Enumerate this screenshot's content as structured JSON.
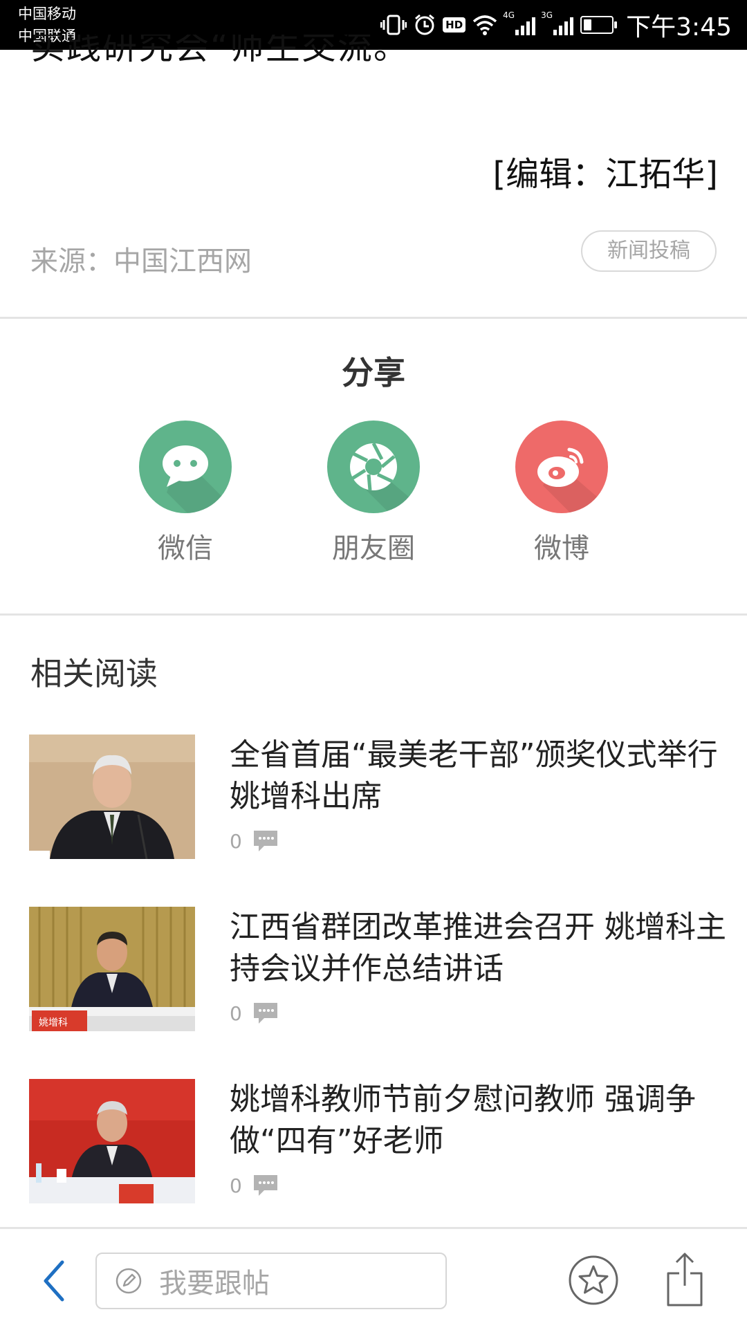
{
  "status_bar": {
    "carrier_1": "中国移动",
    "carrier_2": "中国联通",
    "hd": "HD",
    "net_1": "4G",
    "net_2": "3G",
    "battery_level": 0.3,
    "time": "下午3:45"
  },
  "article": {
    "partial_text": "实践研究会“师生交流。",
    "editor": "[编辑：江拓华]",
    "source": "来源：中国江西网",
    "submit_label": "新闻投稿"
  },
  "share": {
    "title": "分享",
    "items": [
      {
        "label": "微信",
        "icon": "wechat-icon",
        "color": "#5fb48b"
      },
      {
        "label": "朋友圈",
        "icon": "moments-icon",
        "color": "#5fb48b"
      },
      {
        "label": "微博",
        "icon": "weibo-icon",
        "color": "#ee6a69"
      }
    ]
  },
  "related": {
    "title": "相关阅读",
    "items": [
      {
        "title": "全省首届“最美老干部”颁奖仪式举行 姚增科出席",
        "comments": "0"
      },
      {
        "title": "江西省群团改革推进会召开 姚增科主持会议并作总结讲话",
        "comments": "0"
      },
      {
        "title": "姚增科教师节前夕慰问教师 强调争做“四有”好老师",
        "comments": "0"
      }
    ]
  },
  "bottom_bar": {
    "reply_placeholder": "我要跟帖",
    "back_icon": "back-arrow-icon",
    "favorite_icon": "star-icon",
    "share_icon": "share-icon"
  },
  "colors": {
    "accent_blue": "#1e6fc2",
    "wechat_green": "#5fb48b",
    "weibo_red": "#ee6a69"
  }
}
